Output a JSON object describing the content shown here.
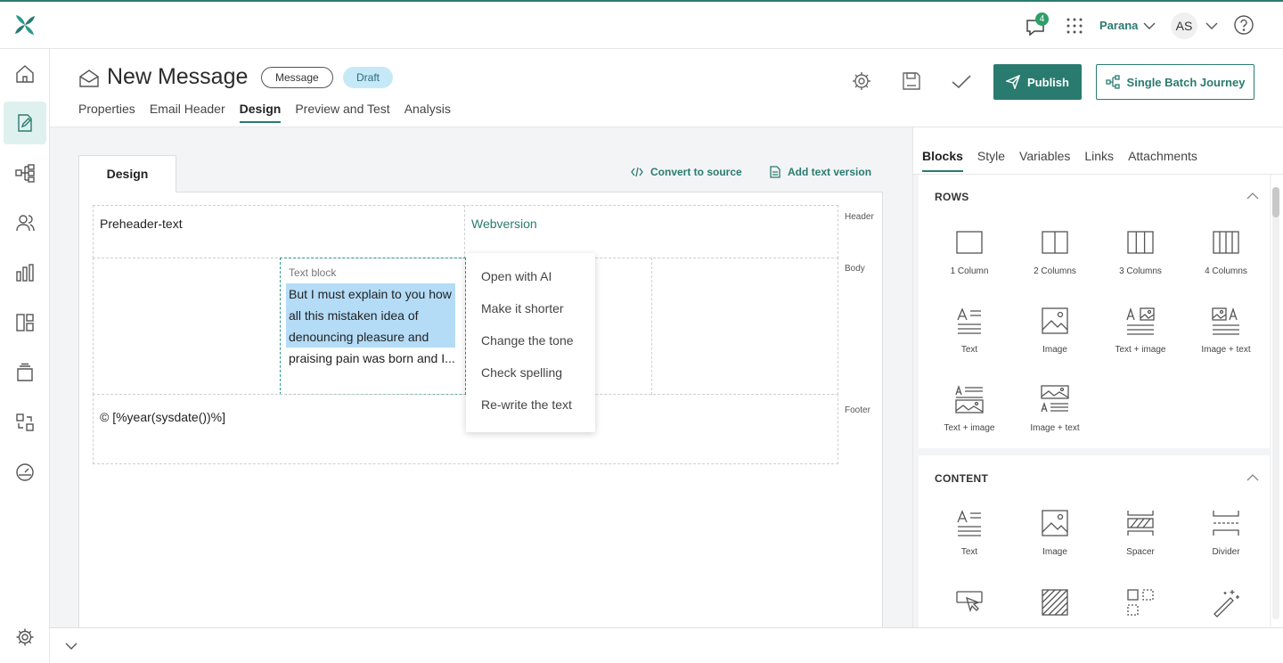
{
  "app": {
    "org_name": "Parana",
    "user_initials": "AS",
    "notification_count": "4"
  },
  "header": {
    "title": "New Message",
    "badge_type": "Message",
    "badge_status": "Draft",
    "tabs": [
      "Properties",
      "Email Header",
      "Design",
      "Preview and Test",
      "Analysis"
    ],
    "active_tab": "Design",
    "publish_label": "Publish",
    "journey_label": "Single Batch Journey"
  },
  "canvas": {
    "design_tab": "Design",
    "convert_label": "Convert to source",
    "add_text_label": "Add text version",
    "header_label": "Header",
    "body_label": "Body",
    "footer_label": "Footer",
    "preheader": "Preheader-text",
    "webversion": "Webversion",
    "textblock_label": "Text block",
    "textblock_lines": [
      "But I must explain to you how",
      "all this mistaken idea of",
      "denouncing pleasure and",
      "praising pain was born and I..."
    ],
    "footer_text": "© [%year(sysdate())%]"
  },
  "context_menu": {
    "items": [
      "Open with AI",
      "Make it shorter",
      "Change the tone",
      "Check spelling",
      "Re-write the text"
    ]
  },
  "panel": {
    "tabs": [
      "Blocks",
      "Style",
      "Variables",
      "Links",
      "Attachments"
    ],
    "active_tab": "Blocks",
    "rows_title": "ROWS",
    "rows_blocks": [
      "1 Column",
      "2 Columns",
      "3 Columns",
      "4 Columns",
      "Text",
      "Image",
      "Text + image",
      "Image + text",
      "Text + image",
      "Image + text"
    ],
    "content_title": "CONTENT",
    "content_blocks": [
      "Text",
      "Image",
      "Spacer",
      "Divider"
    ]
  },
  "colors": {
    "accent": "#2a7b6f",
    "draft_bg": "#c6e9f7",
    "highlight": "#b4dcf7"
  }
}
